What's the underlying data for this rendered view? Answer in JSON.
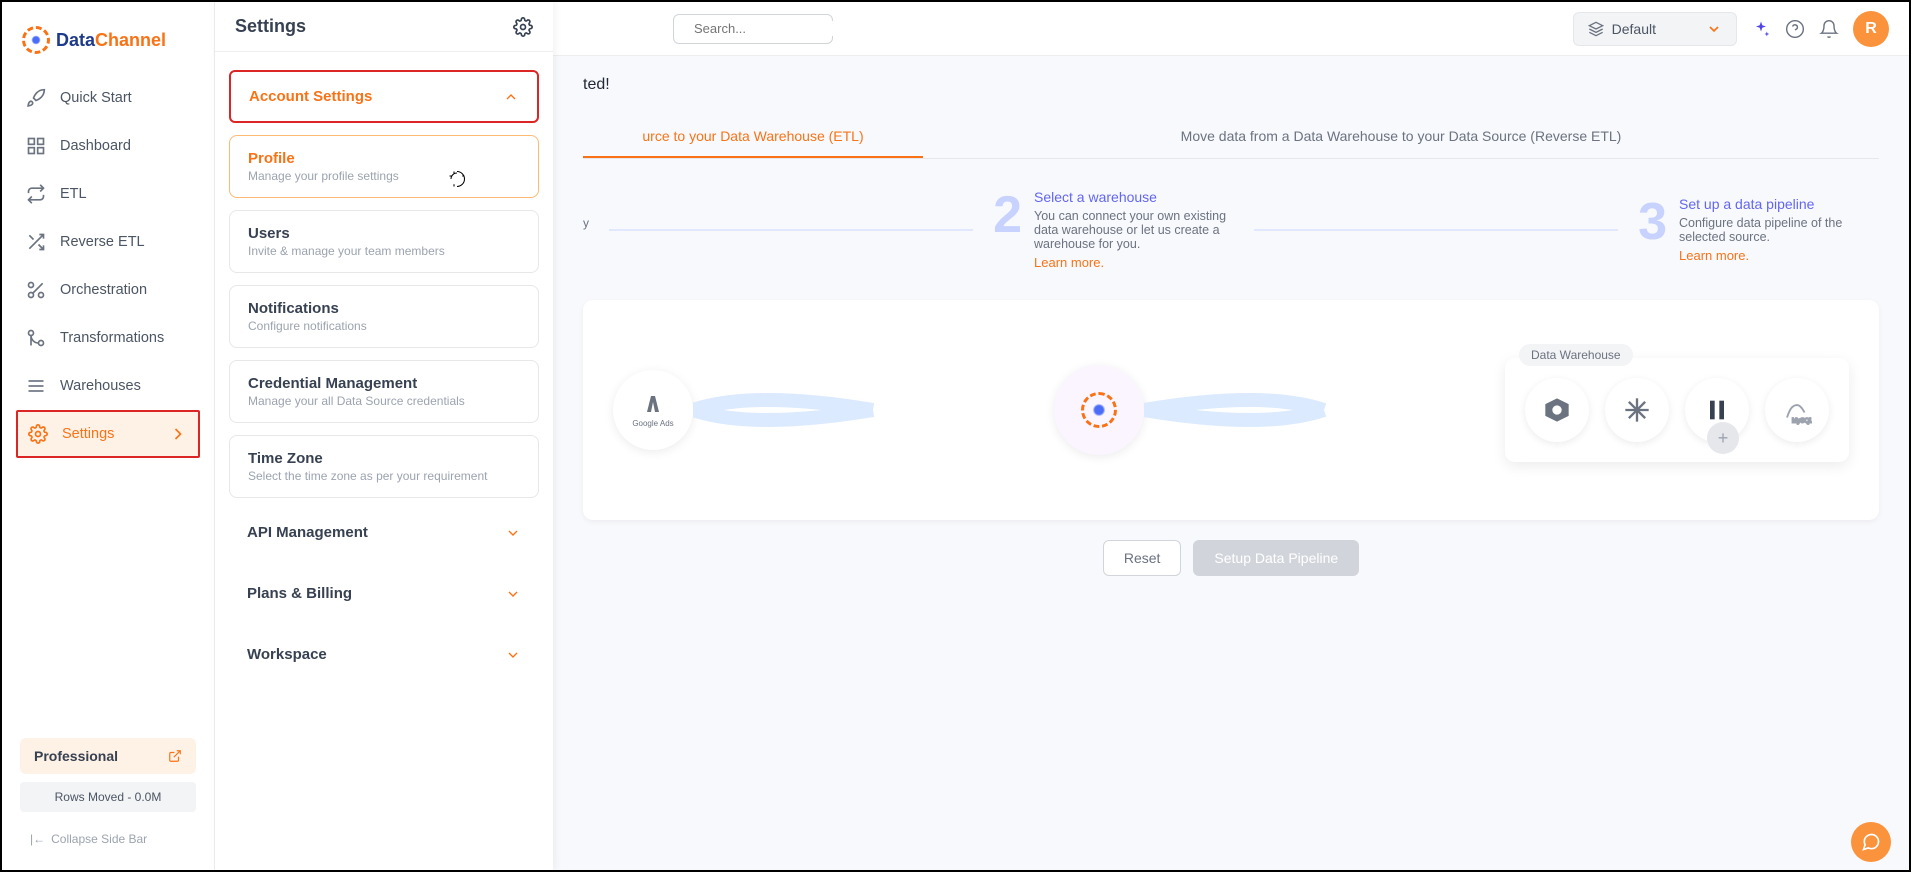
{
  "logo": {
    "part1": "Data",
    "part2": "Channel"
  },
  "sidebar": {
    "items": [
      {
        "label": "Quick Start",
        "name": "nav-quick-start"
      },
      {
        "label": "Dashboard",
        "name": "nav-dashboard"
      },
      {
        "label": "ETL",
        "name": "nav-etl"
      },
      {
        "label": "Reverse ETL",
        "name": "nav-reverse-etl"
      },
      {
        "label": "Orchestration",
        "name": "nav-orchestration"
      },
      {
        "label": "Transformations",
        "name": "nav-transformations"
      },
      {
        "label": "Warehouses",
        "name": "nav-warehouses"
      },
      {
        "label": "Settings",
        "name": "nav-settings"
      }
    ],
    "plan": "Professional",
    "rows_moved": "Rows Moved - 0.0M",
    "collapse": "Collapse Side Bar"
  },
  "settings_panel": {
    "title": "Settings",
    "sections": {
      "account": {
        "title": "Account Settings"
      },
      "items": [
        {
          "title": "Profile",
          "desc": "Manage your profile settings"
        },
        {
          "title": "Users",
          "desc": "Invite & manage your team members"
        },
        {
          "title": "Notifications",
          "desc": "Configure notifications"
        },
        {
          "title": "Credential Management",
          "desc": "Manage your all Data Source credentials"
        },
        {
          "title": "Time Zone",
          "desc": "Select the time zone as per your requirement"
        }
      ],
      "collapsed": [
        {
          "title": "API Management"
        },
        {
          "title": "Plans & Billing"
        },
        {
          "title": "Workspace"
        }
      ]
    }
  },
  "search_placeholder": "Search...",
  "topbar": {
    "dropdown": "Default",
    "avatar_initial": "R"
  },
  "content": {
    "header_suffix": "ted!",
    "tabs": [
      "urce to your Data Warehouse (ETL)",
      "Move data from a Data Warehouse to your Data Source (Reverse ETL)"
    ],
    "step1_frag": "y",
    "learn_plain": "Learn more.",
    "steps": [
      {
        "num": "2",
        "title": "Select a warehouse",
        "text": "You can connect your own existing data warehouse or let us create a warehouse for you.",
        "learn": "Learn more."
      },
      {
        "num": "3",
        "title": "Set up a data pipeline",
        "text": "Configure data pipeline of the selected source.",
        "learn": "Learn more."
      }
    ],
    "dw_label": "Data Warehouse",
    "reset": "Reset",
    "setup": "Setup Data Pipeline"
  }
}
